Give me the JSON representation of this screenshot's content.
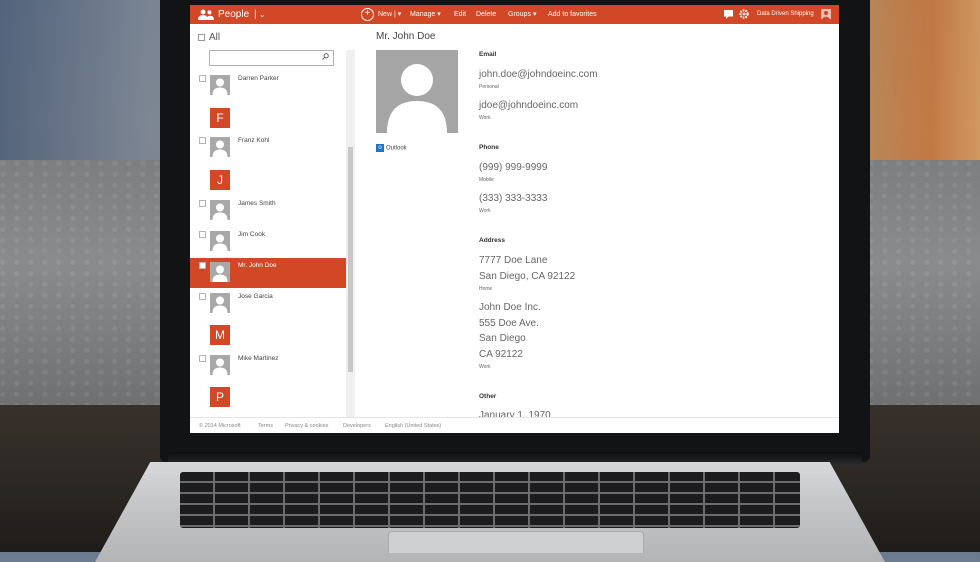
{
  "app": {
    "title": "People"
  },
  "toolbar": {
    "new_label": "New",
    "manage_label": "Manage",
    "edit_label": "Edit",
    "delete_label": "Delete",
    "groups_label": "Groups",
    "favorites_label": "Add to favorites",
    "account_name": "Data Driven Shipping"
  },
  "list": {
    "all_label": "All",
    "search_placeholder": "",
    "contacts": [
      {
        "name": "Darren Parker"
      },
      {
        "letter": "F"
      },
      {
        "name": "Franz Kohl"
      },
      {
        "letter": "J"
      },
      {
        "name": "James Smith"
      },
      {
        "name": "Jim Cook"
      },
      {
        "name": "Mr. John Doe",
        "selected": true
      },
      {
        "name": "Jose Garcia"
      },
      {
        "letter": "M"
      },
      {
        "name": "Mike Martinez"
      },
      {
        "letter": "P"
      }
    ]
  },
  "detail": {
    "name": "Mr. John Doe",
    "source": "Outlook",
    "email_heading": "Email",
    "email_personal": "john.doe@johndoeinc.com",
    "email_personal_label": "Personal",
    "email_work": "jdoe@johndoeinc.com",
    "email_work_label": "Work",
    "phone_heading": "Phone",
    "phone_mobile": "(999) 999-9999",
    "phone_mobile_label": "Mobile",
    "phone_work": "(333) 333-3333",
    "phone_work_label": "Work",
    "address_heading": "Address",
    "home_line1": "7777 Doe Lane",
    "home_line2": "San Diego, CA 92122",
    "home_label": "Home",
    "work_line1": "John Doe Inc.",
    "work_line2": "555 Doe Ave.",
    "work_line3": "San Diego",
    "work_line4": "CA 92122",
    "work_label": "Work",
    "other_heading": "Other",
    "other_value": "January 1, 1970"
  },
  "footer": {
    "copyright": "© 2014 Microsoft",
    "terms": "Terms",
    "privacy": "Privacy & cookies",
    "developers": "Developers",
    "language": "English (United States)"
  },
  "colors": {
    "accent": "#d24726",
    "avatar": "#a8a8a8"
  }
}
